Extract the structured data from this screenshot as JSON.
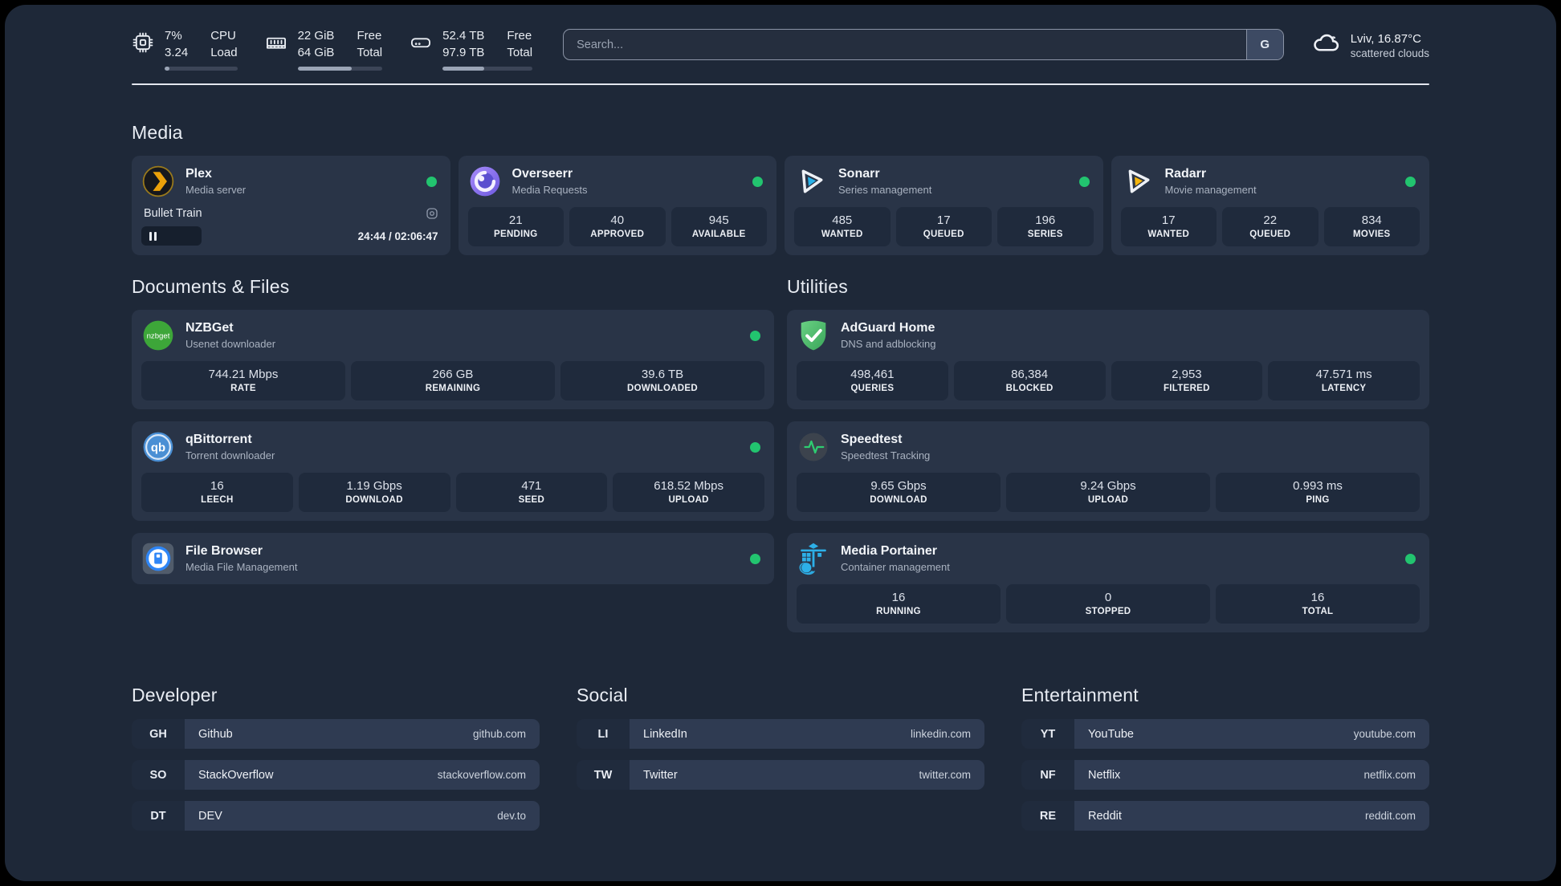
{
  "header": {
    "cpu": {
      "line1": "7%",
      "line2": "3.24",
      "label1": "CPU",
      "label2": "Load",
      "progress": 7
    },
    "ram": {
      "line1": "22 GiB",
      "line2": "64 GiB",
      "label1": "Free",
      "label2": "Total",
      "progress": 64
    },
    "disk": {
      "line1": "52.4 TB",
      "line2": "97.9 TB",
      "label1": "Free",
      "label2": "Total",
      "progress": 46
    },
    "search": {
      "placeholder": "Search...",
      "button_label": "G"
    },
    "weather": {
      "location": "Lviv, 16.87°C",
      "condition": "scattered clouds"
    }
  },
  "sections": {
    "media": "Media",
    "documents": "Documents & Files",
    "utilities": "Utilities",
    "developer": "Developer",
    "social": "Social",
    "entertainment": "Entertainment"
  },
  "apps": {
    "plex": {
      "title": "Plex",
      "subtitle": "Media server",
      "now_playing": "Bullet Train",
      "time": "24:44 / 02:06:47",
      "progress": 20
    },
    "overseerr": {
      "title": "Overseerr",
      "subtitle": "Media Requests",
      "stats": [
        {
          "value": "21",
          "label": "PENDING"
        },
        {
          "value": "40",
          "label": "APPROVED"
        },
        {
          "value": "945",
          "label": "AVAILABLE"
        }
      ]
    },
    "sonarr": {
      "title": "Sonarr",
      "subtitle": "Series management",
      "stats": [
        {
          "value": "485",
          "label": "WANTED"
        },
        {
          "value": "17",
          "label": "QUEUED"
        },
        {
          "value": "196",
          "label": "SERIES"
        }
      ]
    },
    "radarr": {
      "title": "Radarr",
      "subtitle": "Movie management",
      "stats": [
        {
          "value": "17",
          "label": "WANTED"
        },
        {
          "value": "22",
          "label": "QUEUED"
        },
        {
          "value": "834",
          "label": "MOVIES"
        }
      ]
    },
    "nzbget": {
      "title": "NZBGet",
      "subtitle": "Usenet downloader",
      "stats": [
        {
          "value": "744.21 Mbps",
          "label": "RATE"
        },
        {
          "value": "266 GB",
          "label": "REMAINING"
        },
        {
          "value": "39.6 TB",
          "label": "DOWNLOADED"
        }
      ]
    },
    "qbittorrent": {
      "title": "qBittorrent",
      "subtitle": "Torrent downloader",
      "stats": [
        {
          "value": "16",
          "label": "LEECH"
        },
        {
          "value": "1.19 Gbps",
          "label": "DOWNLOAD"
        },
        {
          "value": "471",
          "label": "SEED"
        },
        {
          "value": "618.52 Mbps",
          "label": "UPLOAD"
        }
      ]
    },
    "filebrowser": {
      "title": "File Browser",
      "subtitle": "Media File Management"
    },
    "adguard": {
      "title": "AdGuard Home",
      "subtitle": "DNS and adblocking",
      "stats": [
        {
          "value": "498,461",
          "label": "QUERIES"
        },
        {
          "value": "86,384",
          "label": "BLOCKED"
        },
        {
          "value": "2,953",
          "label": "FILTERED"
        },
        {
          "value": "47.571 ms",
          "label": "LATENCY"
        }
      ]
    },
    "speedtest": {
      "title": "Speedtest",
      "subtitle": "Speedtest Tracking",
      "stats": [
        {
          "value": "9.65 Gbps",
          "label": "DOWNLOAD"
        },
        {
          "value": "9.24 Gbps",
          "label": "UPLOAD"
        },
        {
          "value": "0.993 ms",
          "label": "PING"
        }
      ]
    },
    "portainer": {
      "title": "Media Portainer",
      "subtitle": "Container management",
      "stats": [
        {
          "value": "16",
          "label": "RUNNING"
        },
        {
          "value": "0",
          "label": "STOPPED"
        },
        {
          "value": "16",
          "label": "TOTAL"
        }
      ]
    }
  },
  "links": {
    "developer": [
      {
        "tag": "GH",
        "name": "Github",
        "url": "github.com"
      },
      {
        "tag": "SO",
        "name": "StackOverflow",
        "url": "stackoverflow.com"
      },
      {
        "tag": "DT",
        "name": "DEV",
        "url": "dev.to"
      }
    ],
    "social": [
      {
        "tag": "LI",
        "name": "LinkedIn",
        "url": "linkedin.com"
      },
      {
        "tag": "TW",
        "name": "Twitter",
        "url": "twitter.com"
      }
    ],
    "entertainment": [
      {
        "tag": "YT",
        "name": "YouTube",
        "url": "youtube.com"
      },
      {
        "tag": "NF",
        "name": "Netflix",
        "url": "netflix.com"
      },
      {
        "tag": "RE",
        "name": "Reddit",
        "url": "reddit.com"
      }
    ]
  },
  "colors": {
    "status_online": "#22c46f",
    "background": "#1e2838",
    "card": "#293447",
    "tile": "#1f2a3c"
  }
}
